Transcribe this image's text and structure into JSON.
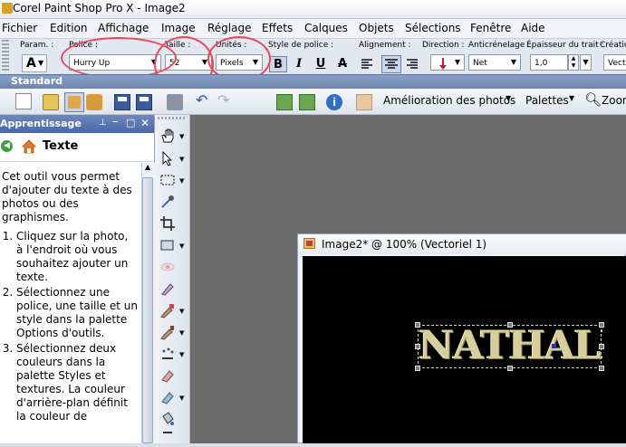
{
  "window": {
    "title": "Corel Paint Shop Pro X - Image2"
  },
  "menu": [
    "Fichier",
    "Edition",
    "Affichage",
    "Image",
    "Réglage",
    "Effets",
    "Calques",
    "Objets",
    "Sélections",
    "Fenêtre",
    "Aide"
  ],
  "options": {
    "param_label": "Param. :",
    "police_label": "Police :",
    "police_value": "Hurry Up",
    "taille_label": "Taille :",
    "taille_value": "52",
    "unites_label": "Unités :",
    "unites_value": "Pixels",
    "style_label": "Style de police :",
    "alignement_label": "Alignement :",
    "direction_label": "Direction :",
    "anticrenelage_label": "Anticrénelage :",
    "anticrenelage_value": "Net",
    "epaisseur_label": "Épaisseur du trait :",
    "epaisseur_value": "1,0",
    "creation_label": "Création",
    "creation_value": "Vecto",
    "bold": "B",
    "italic": "I",
    "underline": "U",
    "strike": "A"
  },
  "standard": {
    "title": "Standard",
    "amelioration": "Amélioration des photos",
    "palettes": "Palettes",
    "zoom": "Zoom"
  },
  "learn": {
    "title": "Apprentissage",
    "heading": "Texte",
    "intro": "Cet outil vous permet d'ajouter du texte à des photos ou des graphismes.",
    "steps": [
      "Cliquez sur la photo, à l'endroit où vous souhaitez ajouter un texte.",
      "Sélectionnez une police, une taille et un style dans la palette Options d'outils.",
      "Sélectionnez deux couleurs dans la palette Styles et textures. La couleur d'arrière-plan définit la couleur de"
    ]
  },
  "image_window": {
    "title": "Image2* @ 100% (Vectoriel 1)"
  },
  "canvas": {
    "text": "NATHALIE"
  },
  "colors": {
    "annotation": "#e8485a",
    "canvas": "#000000",
    "workspace": "#6b6b6b"
  }
}
